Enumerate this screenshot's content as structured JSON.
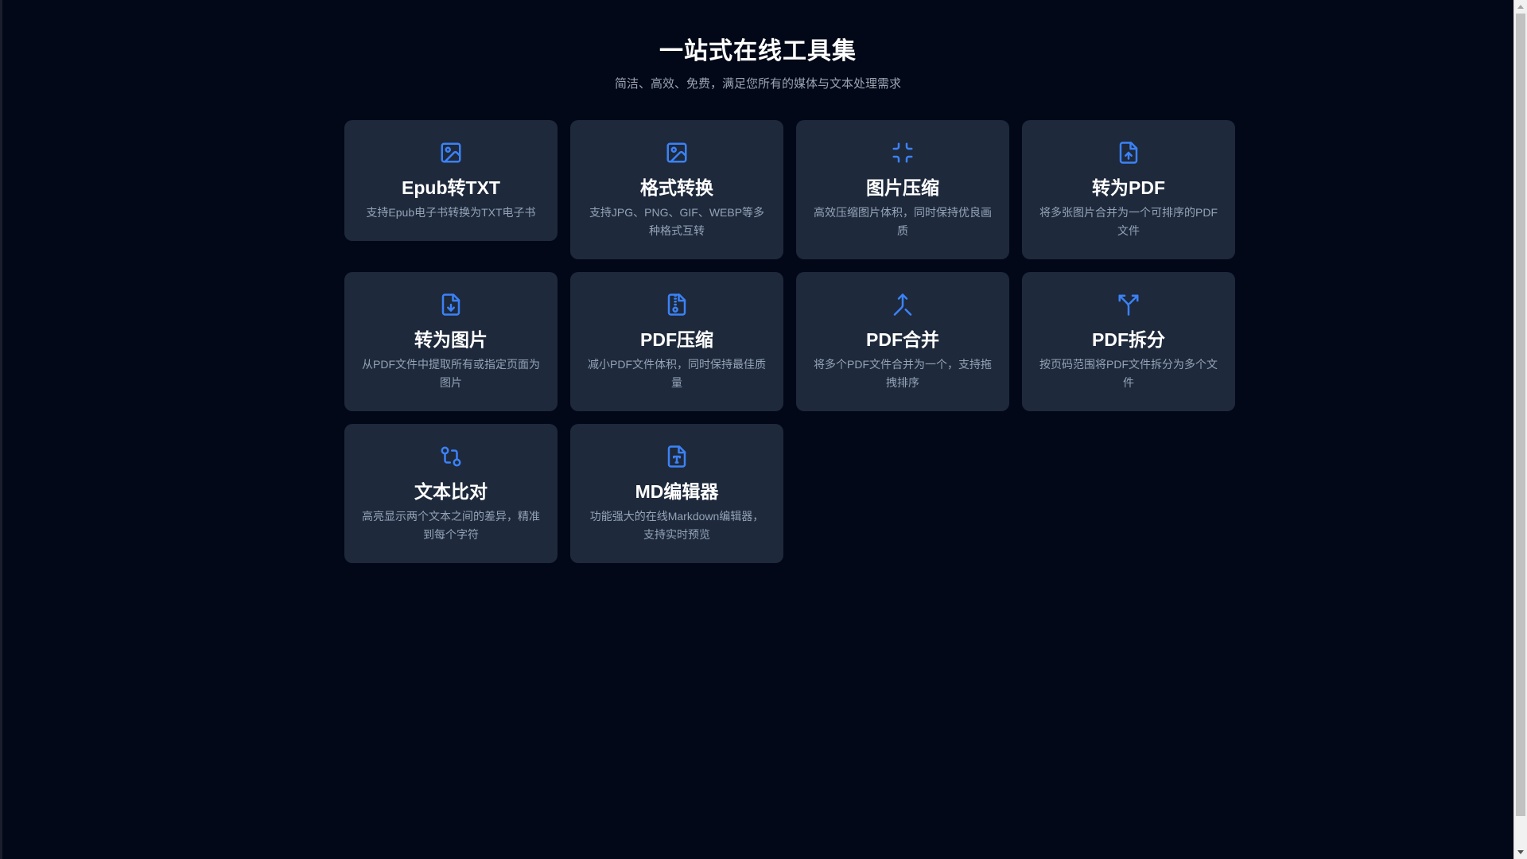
{
  "header": {
    "title": "一站式在线工具集",
    "subtitle": "简洁、高效、免费，满足您所有的媒体与文本处理需求"
  },
  "colors": {
    "background": "#020817",
    "card": "#1e293b",
    "accent": "#3b82f6",
    "title": "#ffffff",
    "description": "#94a3b8"
  },
  "tools": [
    {
      "icon": "image-icon",
      "title": "Epub转TXT",
      "desc": "支持Epub电子书转换为TXT电子书"
    },
    {
      "icon": "image-icon",
      "title": "格式转换",
      "desc": "支持JPG、PNG、GIF、WEBP等多种格式互转"
    },
    {
      "icon": "shrink-icon",
      "title": "图片压缩",
      "desc": "高效压缩图片体积，同时保持优良画质"
    },
    {
      "icon": "file-upload-icon",
      "title": "转为PDF",
      "desc": "将多张图片合并为一个可排序的PDF文件"
    },
    {
      "icon": "file-download-icon",
      "title": "转为图片",
      "desc": "从PDF文件中提取所有或指定页面为图片"
    },
    {
      "icon": "file-archive-icon",
      "title": "PDF压缩",
      "desc": "减小PDF文件体积，同时保持最佳质量"
    },
    {
      "icon": "merge-icon",
      "title": "PDF合并",
      "desc": "将多个PDF文件合并为一个，支持拖拽排序"
    },
    {
      "icon": "split-icon",
      "title": "PDF拆分",
      "desc": "按页码范围将PDF文件拆分为多个文件"
    },
    {
      "icon": "git-compare-icon",
      "title": "文本比对",
      "desc": "高亮显示两个文本之间的差异，精准到每个字符"
    },
    {
      "icon": "file-type-icon",
      "title": "MD编辑器",
      "desc": "功能强大的在线Markdown编辑器，支持实时预览"
    }
  ]
}
